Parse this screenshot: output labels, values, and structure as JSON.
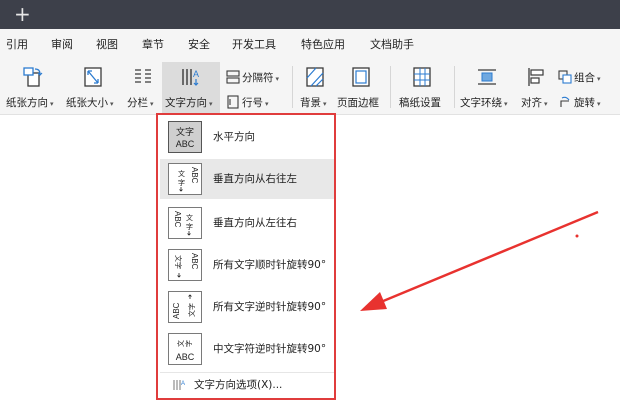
{
  "titlebar": {
    "new_tab_glyph": "+"
  },
  "menu": {
    "items": [
      "引用",
      "审阅",
      "视图",
      "章节",
      "安全",
      "开发工具",
      "特色应用",
      "文档助手"
    ]
  },
  "ribbon": {
    "paper_direction": "纸张方向",
    "paper_size": "纸张大小",
    "columns": "分栏",
    "text_direction": "文字方向",
    "separator": "分隔符",
    "line_number": "行号",
    "background": "背景",
    "page_border": "页面边框",
    "manuscript": "稿纸设置",
    "text_wrap": "文字环绕",
    "align": "对齐",
    "group": "组合",
    "rotate": "旋转",
    "dropdown_arrow": "▾"
  },
  "dropdown": {
    "items": [
      {
        "label": "水平方向",
        "icon": "horizontal-text-icon"
      },
      {
        "label": "垂直方向从右往左",
        "icon": "vertical-rtl-text-icon"
      },
      {
        "label": "垂直方向从左往右",
        "icon": "vertical-ltr-text-icon"
      },
      {
        "label": "所有文字顺时针旋转90°",
        "icon": "rotate-cw-text-icon"
      },
      {
        "label": "所有文字逆时针旋转90°",
        "icon": "rotate-ccw-text-icon"
      },
      {
        "label": "中文字符逆时针旋转90°",
        "icon": "cjk-rotate-ccw-text-icon"
      }
    ],
    "footer": "文字方向选项(X)...",
    "thumb_text": {
      "cjk": "文字",
      "latin": "ABC"
    }
  },
  "colors": {
    "titlebar": "#3d404a",
    "ribbon_bg": "#f5f5f5",
    "highlight_border": "#e03c3c",
    "arrow": "#e8322f"
  }
}
